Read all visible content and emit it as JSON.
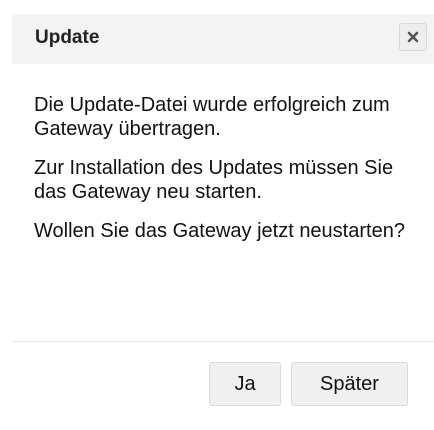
{
  "dialog": {
    "title": "Update",
    "close_icon": "close-icon",
    "paragraphs": [
      "Die Update-Datei wurde erfolgreich zum Gateway übertragen.",
      "Zur Installation des Updates müssen Sie das Gateway neu starten.",
      "Wollen Sie das Gateway jetzt neustarten?"
    ],
    "buttons": {
      "yes_label": "Ja",
      "later_label": "Später"
    }
  }
}
